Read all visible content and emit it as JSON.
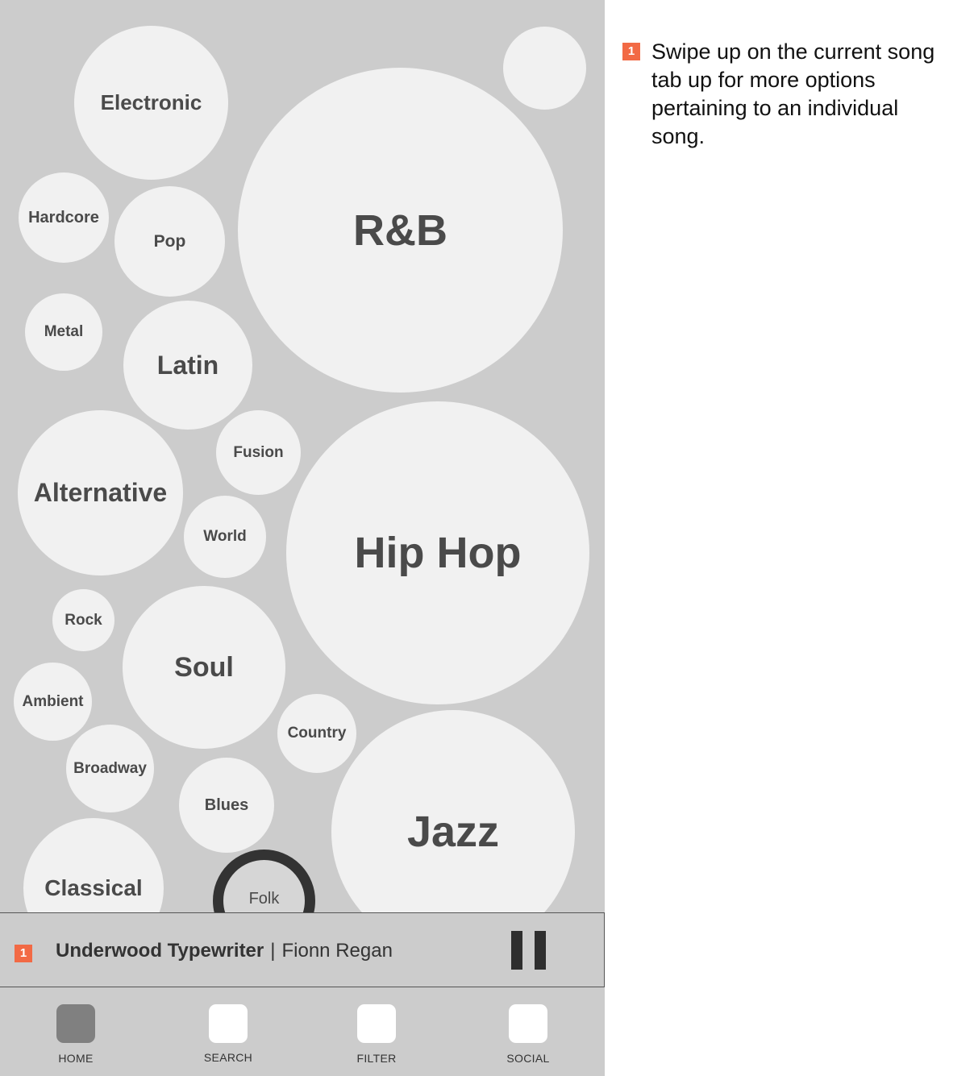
{
  "genres": {
    "electronic": "Electronic",
    "rnb": "R&B",
    "unlabeled": "",
    "hardcore": "Hardcore",
    "pop": "Pop",
    "metal": "Metal",
    "latin": "Latin",
    "fusion": "Fusion",
    "alternative": "Alternative",
    "world": "World",
    "hiphop": "Hip Hop",
    "rock": "Rock",
    "soul": "Soul",
    "ambient": "Ambient",
    "country": "Country",
    "broadway": "Broadway",
    "blues": "Blues",
    "jazz": "Jazz",
    "classical": "Classical",
    "folk": "Folk"
  },
  "now_playing": {
    "badge": "1",
    "title": "Underwood Typewriter",
    "separator": "|",
    "artist": "Fionn Regan",
    "state": "playing"
  },
  "tabs": {
    "home": "HOME",
    "search": "SEARCH",
    "filter": "FILTER",
    "social": "SOCIAL",
    "active": "home"
  },
  "annotation": {
    "badge": "1",
    "text": "Swipe up on the current song tab up for more options pertaining to an individual song."
  },
  "colors": {
    "accent": "#f26a45",
    "background": "#cccccc",
    "bubble": "#f1f1f1",
    "text": "#4a4a4a"
  }
}
